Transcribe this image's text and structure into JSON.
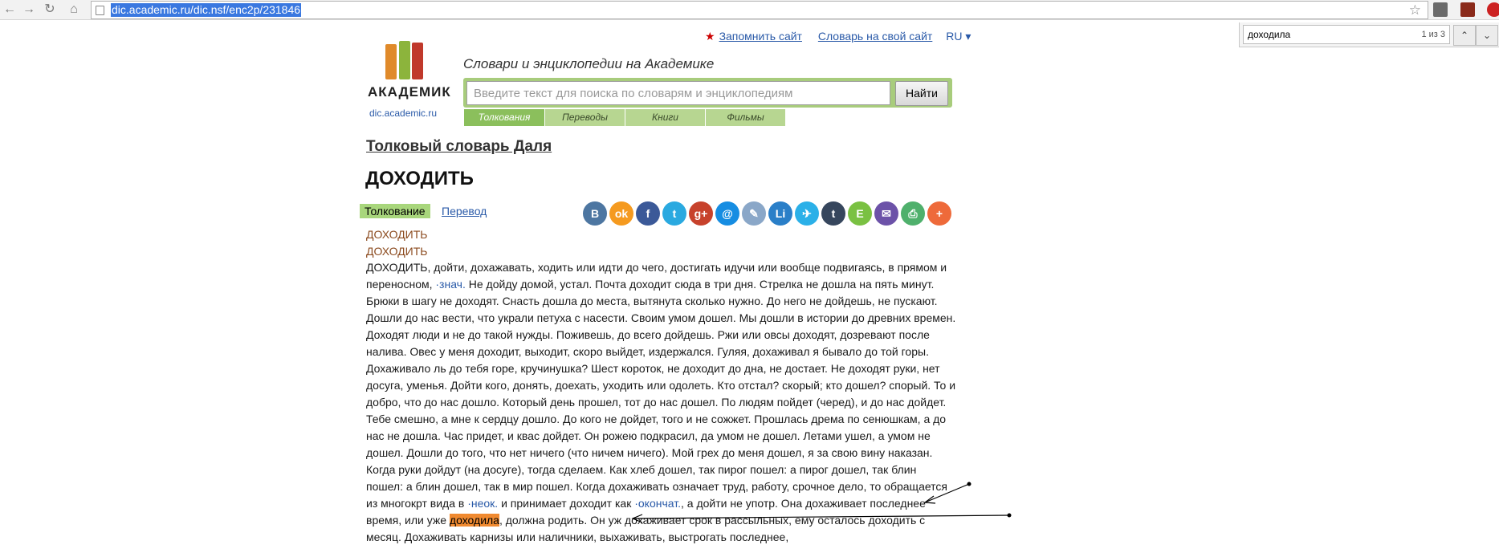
{
  "browser": {
    "url": "dic.academic.ru/dic.nsf/enc2p/231846",
    "back_glyph": "←",
    "forward_glyph": "→",
    "reload_glyph": "↻",
    "home_glyph": "⌂",
    "star_glyph": "☆"
  },
  "findbar": {
    "query": "доходила",
    "count": "1 из 3",
    "prev_glyph": "⌃",
    "next_glyph": "⌄"
  },
  "toplinks": {
    "star": "★",
    "remember": "Запомнить сайт",
    "dict_site": "Словарь на свой сайт",
    "lang": "RU ▾"
  },
  "logo": {
    "name": "АКАДЕМИК",
    "url": "dic.academic.ru"
  },
  "search": {
    "slogan": "Словари и энциклопедии на Академике",
    "placeholder": "Введите текст для поиска по словарям и энциклопедиям",
    "button": "Найти",
    "tabs": [
      "Толкования",
      "Переводы",
      "Книги",
      "Фильмы"
    ]
  },
  "dictionary": {
    "title": "Толковый словарь Даля",
    "headword": "ДОХОДИТЬ",
    "tab_interpretation": "Толкование",
    "tab_translation": "Перевод"
  },
  "share_icons": [
    {
      "label": "B",
      "name": "vk-icon",
      "color": "#4d76a1"
    },
    {
      "label": "ok",
      "name": "odnoklassniki-icon",
      "color": "#f59a1f"
    },
    {
      "label": "f",
      "name": "facebook-icon",
      "color": "#3b5998"
    },
    {
      "label": "t",
      "name": "twitter-icon",
      "color": "#2aa9e0"
    },
    {
      "label": "g+",
      "name": "google-plus-icon",
      "color": "#c7422c"
    },
    {
      "label": "@",
      "name": "mail-icon",
      "color": "#168de2"
    },
    {
      "label": "✎",
      "name": "livejournal-icon",
      "color": "#8aa7c8"
    },
    {
      "label": "Li",
      "name": "liveinternet-icon",
      "color": "#2a7fc8"
    },
    {
      "label": "✈",
      "name": "surfingbird-icon",
      "color": "#2bb0e8"
    },
    {
      "label": "t",
      "name": "tumblr-icon",
      "color": "#36465d"
    },
    {
      "label": "E",
      "name": "evernote-icon",
      "color": "#7ac142"
    },
    {
      "label": "✉",
      "name": "email-icon",
      "color": "#6c52a8"
    },
    {
      "label": "⎙",
      "name": "print-icon",
      "color": "#4fb06c"
    },
    {
      "label": "+",
      "name": "more-icon",
      "color": "#ee6a3a"
    }
  ],
  "variants": [
    "ДОХОДИТЬ",
    "ДОХОДИТЬ"
  ],
  "article": {
    "p1": "ДОХОДИТЬ, дойти, дохажавать, ходить или идти до чего, достигать идучи или вообще подвигаясь, в прямом и переносном, ",
    "link1": "·знач.",
    "p2": " Не дойду домой, устал. Почта доходит сюда в три дня. Стрелка не дошла на пять минут. Брюки в шагу не доходят. Снасть дошла до места, вытянута сколько нужно. До него не дойдешь, не пускают. Дошли до нас вести, что украли петуха с насести. Своим умом дошел. Мы дошли в истории до древних времен. Доходят люди и не до такой нужды. Поживешь, до всего дойдешь. Ржи или овсы доходят, дозревают после налива. Овес у меня доходит, выходит, скоро выйдет, издержался. Гуляя, дохаживал я бывало до той горы. Дохаживало ль до тебя горе, кручинушка? Шест короток, не доходит до дна, не достает. Не доходят руки, нет досуга, уменья. Дойти кого, донять, доехать, уходить или одолеть. Кто отстал? скорый; кто дошел? спорый. То и добро, что до нас дошло. Который день прошел, тот до нас дошел. По людям пойдет (черед), и до нас дойдет. Тебе смешно, а мне к сердцу дошло. До кого не дойдет, того и не сожжет. Прошлась дрема по сенюшкам, а до нас не дошла. Час придет, и квас дойдет. Он рожею подкрасил, да умом не дошел. Летами ушел, а умом не дошел. Дошли до того, что нет ничего (что ничем ничего). Мой грех до меня дошел, я за свою вину наказан. Когда руки дойдут (на досуге), тогда сделаем. Как хлеб дошел, так пирог пошел: а пирог дошел, так блин пошел: а блин дошел, так в мир пошел. Когда дохаживать означает труд, работу, срочное дело, то обращается из многокрт вида в ",
    "link2": "·неок.",
    "p3": " и принимает доходит как ",
    "link3": "·окончат.",
    "p4": ", а дойти не употр. Она дохаживает последнее время, или уже ",
    "highlight": "доходила",
    "p5": ", должна родить. Он уж дохаживает срок в рассыльных, ему осталось доходить с месяц. Дохаживать карнизы или наличники, выхаживать, выстрогать последнее,"
  }
}
